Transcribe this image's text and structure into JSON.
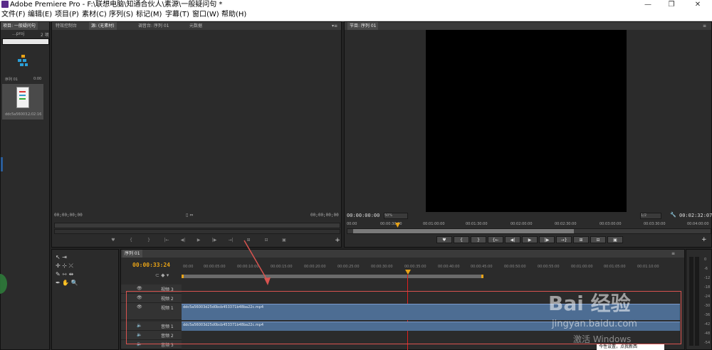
{
  "window": {
    "title": "Adobe Premiere Pro - F:\\联想电脑\\知通合伙人\\素源\\一般疑问句 *",
    "minimize": "—",
    "maximize": "❐",
    "close": "✕"
  },
  "menu": [
    "文件(F)",
    "编辑(E)",
    "项目(P)",
    "素材(C)",
    "序列(S)",
    "标记(M)",
    "字幕(T)",
    "窗口(W)",
    "帮助(H)"
  ],
  "project": {
    "tab": "项目: 一般疑问句",
    "project_file": "...proj",
    "item_count": "2 项",
    "search_placeholder": "",
    "items": [
      {
        "name": "序列 01",
        "duration": "0:00"
      },
      {
        "name": "ddc5a56003...",
        "duration": "2:02:16"
      }
    ]
  },
  "source": {
    "tabs": [
      "特效控制台",
      "源: (无素材)",
      "调音台: 序列 01",
      "元数据"
    ],
    "timecode_left": "00;00;00;00",
    "timecode_right": "00;00;00;00"
  },
  "program": {
    "tab": "节目: 序列 01",
    "timecode_current": "00:00:00:00",
    "zoom": "50%",
    "resolution": "1/2",
    "timecode_duration": "00:02:32:07",
    "ruler": [
      "00:00",
      "00:00:30:00",
      "00:01:00:00",
      "00:01:30:00",
      "00:02:00:00",
      "00:02:30:00",
      "00:03:00:00",
      "00:03:30:00",
      "00:04:00:00"
    ]
  },
  "timeline": {
    "tab": "序列 01",
    "timecode": "00:00:33:24",
    "ruler": [
      "00:00",
      "00:00:05:00",
      "00:00:10:00",
      "00:00:15:00",
      "00:00:20:00",
      "00:00:25:00",
      "00:00:30:00",
      "00:00:35:00",
      "00:00:40:00",
      "00:00:45:00",
      "00:00:50:00",
      "00:00:55:00",
      "00:01:00:00",
      "00:01:05:00",
      "00:01:10:00"
    ],
    "tracks": [
      "视频 3",
      "视频 2",
      "视频 1",
      "音频 1",
      "音频 2",
      "音频 3"
    ],
    "video_clip": "ddc5a56003d25d0bcb453371b48ba22c.mp4",
    "audio_clip": "ddc5a56003d25d0bcb453371b48ba22c.mp4"
  },
  "meter": [
    "0",
    "-6",
    "-12",
    "-18",
    "-24",
    "-30",
    "-36",
    "-42",
    "-48",
    "-54"
  ],
  "overlay": {
    "watermark_brand": "Bai 经验",
    "watermark_url": "jingyan.baidu.com",
    "activate_windows": "激活 Windows",
    "tooltip": "今性设置，点我新西"
  },
  "colors": {
    "accent_timecode": "#e8a317",
    "clip_blue": "#4d6d93",
    "annotation_red": "#d9534f",
    "playhead": "#e02020"
  }
}
